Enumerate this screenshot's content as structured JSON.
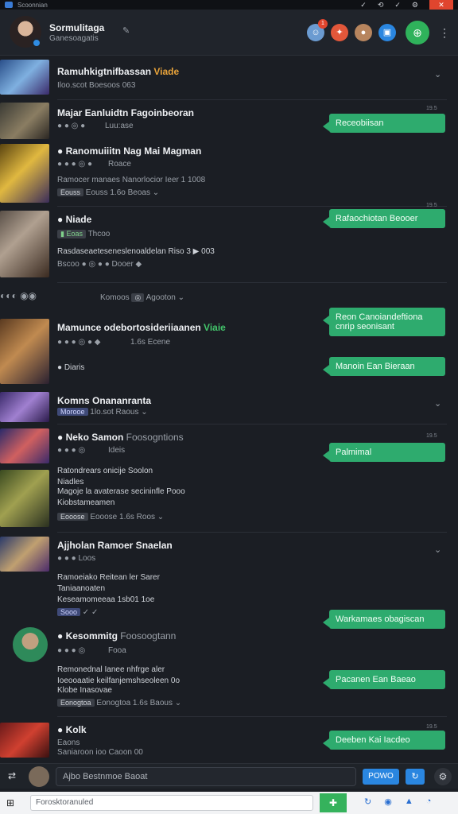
{
  "topbar": {
    "title": "Scoonnian",
    "icons": [
      "check-icon",
      "link-icon",
      "pin-icon",
      "gear-icon"
    ],
    "close": "✕"
  },
  "header": {
    "title": "Sormulitaga",
    "subtitle": "Ganesoagatis",
    "pin_icon": "✎",
    "badge": "1"
  },
  "rows": [
    {
      "name": "Ramuhkigtnifbassan",
      "tag": "Viade",
      "meta": "Iloo.scot   Boesoos 063"
    },
    {
      "name": "Majar Eanluidtn Fagoinbeoran",
      "meta": "Luu:ase"
    },
    {
      "name": "Ranomuiiitn Nag Mai Magman",
      "meta": "Roace",
      "line1": "Ramocer manaes Nanorlocior Ieer 1 1008",
      "meta2": "Eouss   1.6o   Beoas ⌄"
    },
    {
      "name": "Niade",
      "meta": "Thcoo",
      "line1": "Rasdaseaeteseneslenoaldelan Riso 3  ▶ 003",
      "meta2": "Dooer"
    },
    {
      "name": "Komoos",
      "meta2": "Agooton ⌄"
    },
    {
      "name": "Mamunce odebortosideriiaanen",
      "tag": "Viaie",
      "meta": "1.6s   Ecene",
      "line1": "Diaris"
    },
    {
      "name": "Komns Onananranta",
      "chip": "Morooe",
      "meta": "1lo.sot   Raous ⌄"
    },
    {
      "name": "Neko Samon",
      "extra": "Foosogntions",
      "meta": "Ideis",
      "line1": "Ratondrears onicije    Soolon",
      "line2": "Niadles",
      "line3": "Magoje la avaterase secininfle  Pooo",
      "line4": "Kiobstameamen",
      "meta2": "Eooose   1.6s   Roos ⌄"
    },
    {
      "name": "Ajjholan Ramoer Snaelan",
      "meta": "Loos",
      "line1": "Ramoeiako Reitean ler Sarer",
      "line2": "Taniaanoaten",
      "line3": "Keseamomeeaa 1sb01 1oe",
      "chip": "Sooo"
    },
    {
      "name": "Kesommitg",
      "extra": "Foosoogtann",
      "meta": "Fooa",
      "line1": "Remonednal Ianee nhfrge aler",
      "line2": "Ioeooaatie keilfanjemshseoleen  0o",
      "line3": "Klobe Inasovae",
      "meta2": "Eonogtoa   1.6s   Baous ⌄"
    },
    {
      "name": "Kolk",
      "meta": "Eaons",
      "line1": "Saniaroon ioo   Caoon 00"
    }
  ],
  "bubbles": [
    {
      "text": "Receobiisan",
      "ts": "19.5"
    },
    {
      "text": "Rafaochiotan Beooer",
      "ts": "19.5"
    },
    {
      "text": "Reon Canoiandeftiona cnrip seonisant",
      "ts": ""
    },
    {
      "text": "Manoin Ean Bieraan",
      "ts": ""
    },
    {
      "text": "Palmimal",
      "ts": "19.5"
    },
    {
      "text": "Warkamaes obagiscan",
      "ts": ""
    },
    {
      "text": "Pacanen Ean Baeao",
      "ts": ""
    },
    {
      "text": "Deeben Kai Iacdeo",
      "ts": "19.5"
    }
  ],
  "input": {
    "placeholder": "Ajbo Bestnmoe Baoat",
    "send": "POWO",
    "refresh": "↻",
    "gear": "⚙"
  },
  "taskbar": {
    "search": "Forosktoranuled",
    "icons": [
      "↻",
      "◉",
      "▲",
      "◔"
    ]
  },
  "colors": {
    "accent_green": "#2eab6e",
    "accent_blue": "#2a86e0",
    "bg": "#1b1e24"
  }
}
